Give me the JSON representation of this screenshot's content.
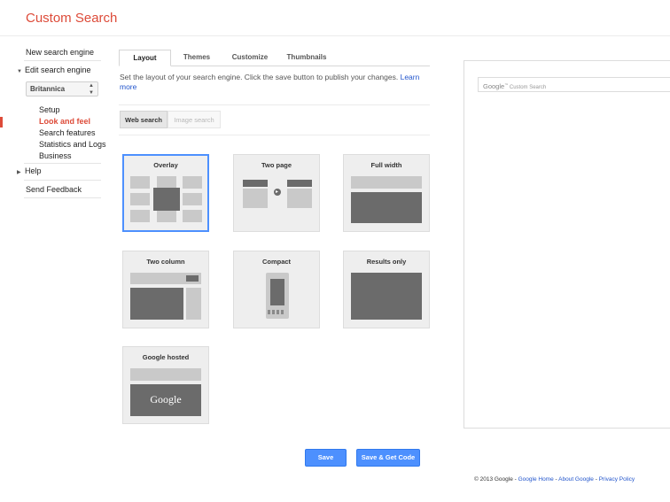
{
  "header": {
    "title": "Custom Search"
  },
  "sidebar": {
    "new_engine": "New search engine",
    "edit_engine": "Edit search engine",
    "selected_engine": "Britannica",
    "sub_items": [
      "Setup",
      "Look and feel",
      "Search features",
      "Statistics and Logs",
      "Business"
    ],
    "help": "Help",
    "feedback": "Send Feedback"
  },
  "tabs": [
    "Layout",
    "Themes",
    "Customize",
    "Thumbnails"
  ],
  "description": {
    "text": "Set the layout of your search engine. Click the save button to publish your changes. ",
    "link": "Learn more"
  },
  "search_types": [
    "Web search",
    "Image search"
  ],
  "layouts": {
    "overlay": "Overlay",
    "two_page": "Two page",
    "full_width": "Full width",
    "two_column": "Two column",
    "compact": "Compact",
    "results_only": "Results only",
    "google_hosted": "Google hosted",
    "google_hosted_logo": "Google"
  },
  "preview": {
    "logo": "Google",
    "tm": "™",
    "placeholder": "Custom Search"
  },
  "buttons": {
    "save": "Save",
    "save_get_code": "Save & Get Code"
  },
  "footer": {
    "copyright": "© 2013 Google",
    "sep": " - ",
    "links": [
      "Google Home",
      "About Google",
      "Privacy Policy"
    ]
  },
  "colors": {
    "accent_red": "#dd4b39",
    "button_blue": "#4d90fe",
    "selected_border": "#4d90fe"
  }
}
